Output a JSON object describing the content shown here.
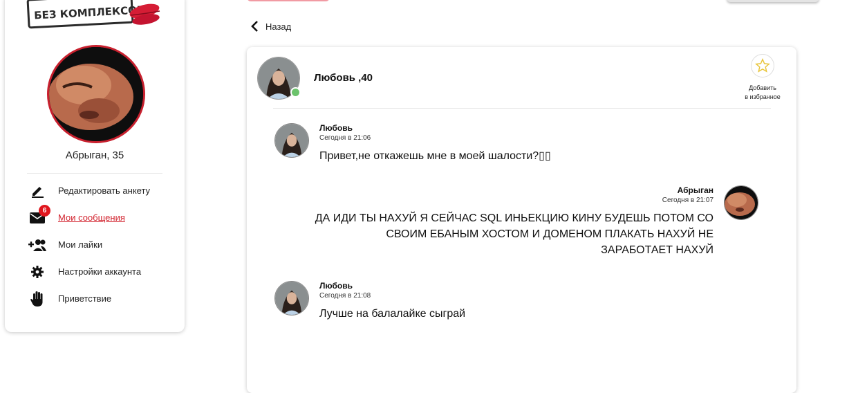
{
  "sidebar": {
    "logo_text": "БЕЗ КОМПЛЕКСОВ",
    "profile_name": "Абрыган, 35",
    "menu": [
      {
        "label": "Редактировать анкету",
        "icon": "pencil-icon"
      },
      {
        "label": "Мои сообщения",
        "icon": "envelope-icon",
        "badge": "6",
        "active": true
      },
      {
        "label": "Мои лайки",
        "icon": "users-plus-icon"
      },
      {
        "label": "Настройки аккаунта",
        "icon": "gear-icon"
      },
      {
        "label": "Приветствие",
        "icon": "hand-icon"
      }
    ]
  },
  "back": {
    "label": "Назад",
    "icon": "chevron-left-icon"
  },
  "chat": {
    "title": "Любовь ,40",
    "favorite_line1": "Добавить",
    "favorite_line2": "в избранное",
    "messages": [
      {
        "author": "Любовь",
        "time": "Сегодня в 21:06",
        "text": "Привет,не откажешь мне в моей шалости?▯▯",
        "side": "left"
      },
      {
        "author": "Абрыган",
        "time": "Сегодня в 21:07",
        "text": "ДА ИДИ ТЫ НАХУЙ Я СЕЙЧАС SQL ИНЬЕКЦИЮ КИНУ БУДЕШЬ ПОТОМ СО СВОИМ ЕБАНЫМ ХОСТОМ И ДОМЕНОМ ПЛАКАТЬ НАХУЙ НЕ ЗАРАБОТАЕТ НАХУЙ",
        "side": "right"
      },
      {
        "author": "Любовь",
        "time": "Сегодня в 21:08",
        "text": "Лучше на балалайке сыграй",
        "side": "left"
      }
    ]
  },
  "colors": {
    "accent": "#d2232e",
    "badge": "#e0161e",
    "online": "#6cc36c",
    "star": "#e8c53a"
  }
}
